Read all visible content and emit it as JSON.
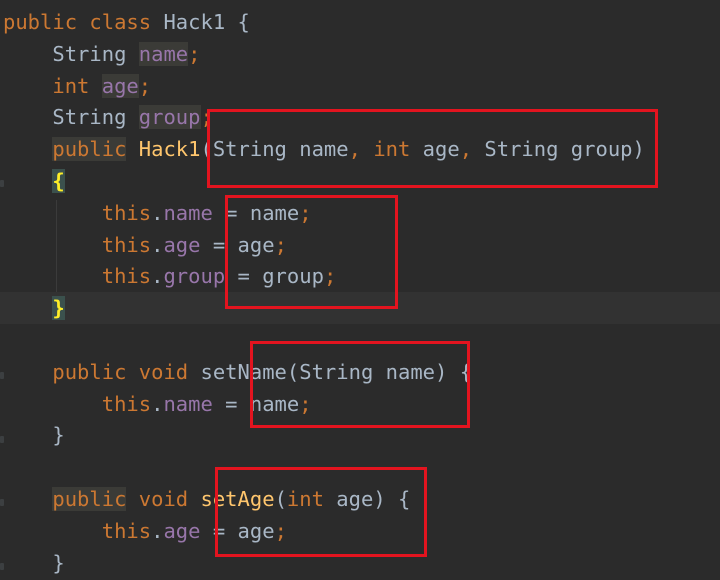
{
  "editor": {
    "language": "Java",
    "theme_colors": {
      "background": "#2b2b2b",
      "keyword": "#cc7832",
      "method": "#ffc66d",
      "field": "#9876aa",
      "text": "#a9b7c6",
      "annotation_box": "#e3141f"
    },
    "lines": [
      {
        "tokens": [
          {
            "t": "public",
            "c": "kw"
          },
          {
            "t": " "
          },
          {
            "t": "class",
            "c": "kw"
          },
          {
            "t": " "
          },
          {
            "t": "Hack1",
            "c": "plain"
          },
          {
            "t": " {",
            "c": "plain"
          }
        ]
      },
      {
        "tokens": [
          {
            "t": "    "
          },
          {
            "t": "String",
            "c": "plain"
          },
          {
            "t": " "
          },
          {
            "t": "name",
            "c": "fld hl-read"
          },
          {
            "t": ";",
            "c": "kw"
          }
        ]
      },
      {
        "tokens": [
          {
            "t": "    "
          },
          {
            "t": "int",
            "c": "kw"
          },
          {
            "t": " "
          },
          {
            "t": "age",
            "c": "fld hl-read"
          },
          {
            "t": ";",
            "c": "kw"
          }
        ]
      },
      {
        "tokens": [
          {
            "t": "    "
          },
          {
            "t": "String",
            "c": "plain"
          },
          {
            "t": " "
          },
          {
            "t": "group",
            "c": "fld hl-read"
          },
          {
            "t": ";",
            "c": "kw"
          }
        ]
      },
      {
        "tokens": [
          {
            "t": "    "
          },
          {
            "t": "public",
            "c": "kw hl-kw-match"
          },
          {
            "t": " "
          },
          {
            "t": "Hack1",
            "c": "fn"
          },
          {
            "t": "(",
            "c": "plain"
          },
          {
            "t": "String",
            "c": "plain"
          },
          {
            "t": " name",
            "c": "plain"
          },
          {
            "t": ",",
            "c": "kw"
          },
          {
            "t": " "
          },
          {
            "t": "int",
            "c": "kw"
          },
          {
            "t": " age",
            "c": "plain"
          },
          {
            "t": ",",
            "c": "kw"
          },
          {
            "t": " "
          },
          {
            "t": "String",
            "c": "plain"
          },
          {
            "t": " group",
            "c": "plain"
          },
          {
            "t": ")",
            "c": "plain"
          }
        ]
      },
      {
        "tokens": [
          {
            "t": "    "
          },
          {
            "t": "{",
            "c": "hl-brace"
          }
        ]
      },
      {
        "tokens": [
          {
            "t": "        "
          },
          {
            "t": "this",
            "c": "kw"
          },
          {
            "t": ".",
            "c": "plain"
          },
          {
            "t": "name",
            "c": "fld"
          },
          {
            "t": " = ",
            "c": "plain"
          },
          {
            "t": "name",
            "c": "plain"
          },
          {
            "t": ";",
            "c": "kw"
          }
        ]
      },
      {
        "tokens": [
          {
            "t": "        "
          },
          {
            "t": "this",
            "c": "kw"
          },
          {
            "t": ".",
            "c": "plain"
          },
          {
            "t": "age",
            "c": "fld"
          },
          {
            "t": " = ",
            "c": "plain"
          },
          {
            "t": "age",
            "c": "plain"
          },
          {
            "t": ";",
            "c": "kw"
          }
        ]
      },
      {
        "tokens": [
          {
            "t": "        "
          },
          {
            "t": "this",
            "c": "kw"
          },
          {
            "t": ".",
            "c": "plain"
          },
          {
            "t": "group",
            "c": "fld"
          },
          {
            "t": " = ",
            "c": "plain"
          },
          {
            "t": "group",
            "c": "plain"
          },
          {
            "t": ";",
            "c": "kw"
          }
        ]
      },
      {
        "current": true,
        "tokens": [
          {
            "t": "    "
          },
          {
            "t": "}",
            "c": "hl-brace"
          }
        ]
      },
      {
        "tokens": []
      },
      {
        "tokens": [
          {
            "t": "    "
          },
          {
            "t": "public",
            "c": "kw"
          },
          {
            "t": " "
          },
          {
            "t": "void",
            "c": "kw"
          },
          {
            "t": " "
          },
          {
            "t": "setName",
            "c": "plain"
          },
          {
            "t": "(",
            "c": "plain"
          },
          {
            "t": "String",
            "c": "plain"
          },
          {
            "t": " name",
            "c": "plain"
          },
          {
            "t": ")",
            "c": "plain"
          },
          {
            "t": " {",
            "c": "plain"
          }
        ]
      },
      {
        "tokens": [
          {
            "t": "        "
          },
          {
            "t": "this",
            "c": "kw"
          },
          {
            "t": ".",
            "c": "plain"
          },
          {
            "t": "name",
            "c": "fld"
          },
          {
            "t": " = ",
            "c": "plain"
          },
          {
            "t": "name",
            "c": "plain"
          },
          {
            "t": ";",
            "c": "kw"
          }
        ]
      },
      {
        "tokens": [
          {
            "t": "    "
          },
          {
            "t": "}",
            "c": "plain"
          }
        ]
      },
      {
        "tokens": []
      },
      {
        "tokens": [
          {
            "t": "    "
          },
          {
            "t": "public",
            "c": "kw hl-kw-match"
          },
          {
            "t": " "
          },
          {
            "t": "void",
            "c": "kw"
          },
          {
            "t": " "
          },
          {
            "t": "setAge",
            "c": "fn"
          },
          {
            "t": "(",
            "c": "plain"
          },
          {
            "t": "int",
            "c": "kw"
          },
          {
            "t": " age",
            "c": "plain"
          },
          {
            "t": ")",
            "c": "plain"
          },
          {
            "t": " {",
            "c": "plain"
          }
        ]
      },
      {
        "tokens": [
          {
            "t": "        "
          },
          {
            "t": "this",
            "c": "kw"
          },
          {
            "t": ".",
            "c": "plain"
          },
          {
            "t": "age",
            "c": "fld"
          },
          {
            "t": " = ",
            "c": "plain"
          },
          {
            "t": "age",
            "c": "plain"
          },
          {
            "t": ";",
            "c": "kw"
          }
        ]
      },
      {
        "tokens": [
          {
            "t": "    "
          },
          {
            "t": "}",
            "c": "plain"
          }
        ]
      }
    ]
  },
  "annotations": {
    "count": 4
  }
}
